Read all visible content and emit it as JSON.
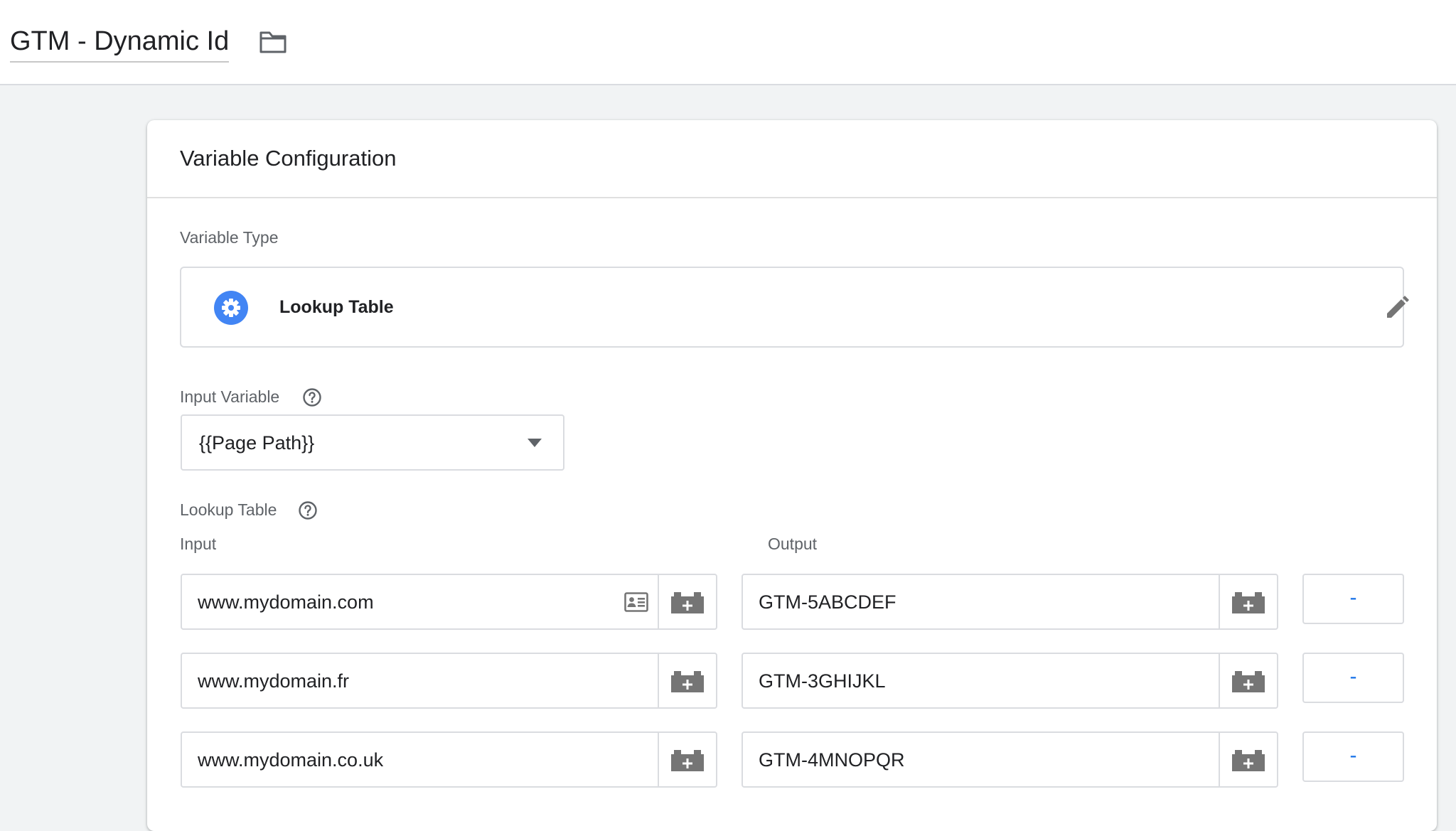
{
  "header": {
    "title": "GTM - Dynamic Id",
    "folder_icon": "folder-icon"
  },
  "card": {
    "title": "Variable Configuration"
  },
  "variable_type": {
    "label": "Variable Type",
    "name": "Lookup Table",
    "icon": "gear-icon",
    "edit_icon": "pencil-icon",
    "accent": "#4285f4"
  },
  "input_variable": {
    "label": "Input Variable",
    "value": "{{Page Path}}"
  },
  "lookup_table": {
    "label": "Lookup Table",
    "input_header": "Input",
    "output_header": "Output",
    "remove_label": "-",
    "rows": [
      {
        "input": "www.mydomain.com",
        "output": "GTM-5ABCDEF"
      },
      {
        "input": "www.mydomain.fr",
        "output": "GTM-3GHIJKL"
      },
      {
        "input": "www.mydomain.co.uk",
        "output": "GTM-4MNOPQR"
      }
    ]
  }
}
